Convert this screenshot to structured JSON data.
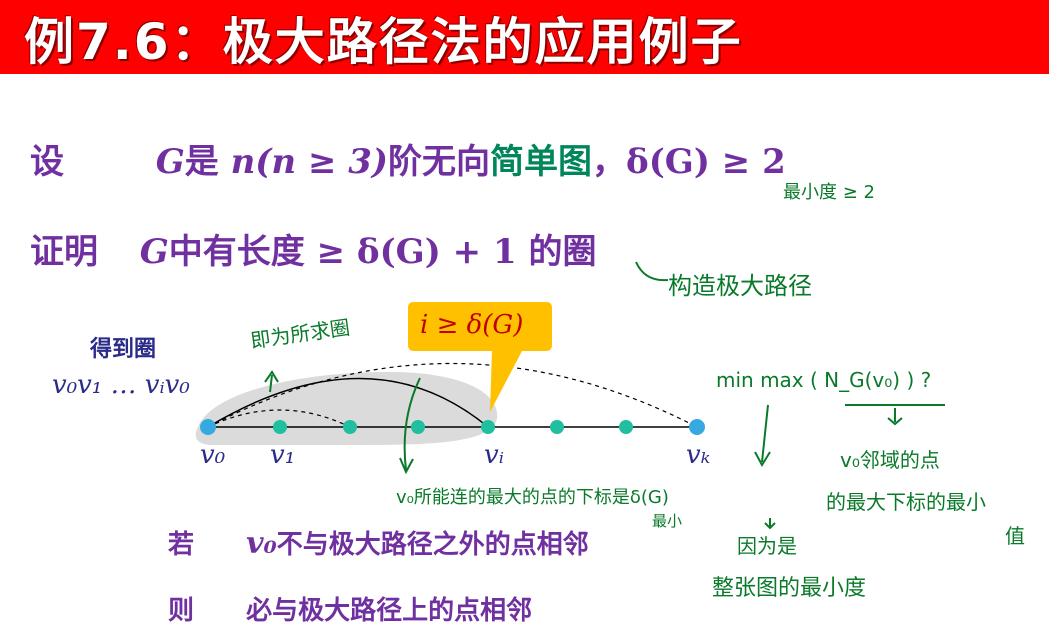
{
  "title": "例7.6：极大路径法的应用例子",
  "given": {
    "label": "设",
    "G": "G",
    "is": "是",
    "order": "n(n ≥ 3)",
    "text": "阶无向",
    "simple": "简单图",
    "comma": "，",
    "cond": "δ(G) ≥ 2"
  },
  "prove": {
    "label": "证明",
    "G": "G",
    "mid": "中有长度",
    "expr": "≥ δ(G) + 1",
    "tail": "的圈"
  },
  "figure": {
    "got_cycle": "得到圈",
    "cycle_math": "v₀v₁ … vᵢv₀",
    "callout": "i ≥ δ(G)",
    "labels": {
      "v0": "v₀",
      "v1": "v₁",
      "vi": "vᵢ",
      "vk": "vₖ"
    }
  },
  "if_line": {
    "label": "若",
    "v0": "v₀",
    "text": "不与极大路径之外的点相邻"
  },
  "then_line": {
    "label": "则",
    "text": "必与极大路径上的点相邻"
  },
  "handwriting": {
    "min_deg": "最小度 ≥ 2",
    "construct": "构造极大路径",
    "desired_cycle": "即为所求圈",
    "minmax": "min max ( N_G(v₀) ) ?",
    "v0_neighbors_1": "v₀邻域的点",
    "v0_neighbors_2": "的最大下标的最小",
    "v0_neighbors_3": "值",
    "v0_reach": "v₀所能连的最大的点的下标是δ(G)",
    "min_small": "最小",
    "because": "因为是",
    "whole_graph": "整张图的最小度"
  },
  "colors": {
    "banner": "#ff0000",
    "text_purple": "#7030a0",
    "simple_green": "#00865a",
    "node_teal": "#1fbf9f",
    "node_blue": "#36a9e1",
    "callout": "#ffc000",
    "callout_text": "#c00000",
    "handwriting": "#0a7a2a",
    "highlight": "#c8c8c8"
  }
}
